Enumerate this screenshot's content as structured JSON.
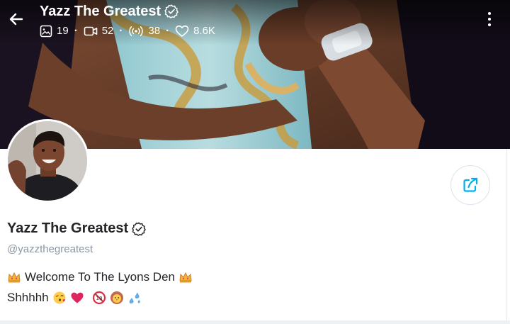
{
  "header": {
    "title": "Yazz The Greatest",
    "stats": {
      "photos": "19",
      "videos": "52",
      "streams": "38",
      "likes": "8.6K"
    }
  },
  "profile": {
    "display_name": "Yazz The Greatest",
    "username": "@yazzthegreatest",
    "bio_line1": "Welcome To The Lyons Den",
    "bio_line2": "Shhhhh"
  },
  "colors": {
    "accent": "#00aff0",
    "muted_text": "#8a96a3",
    "text": "#242529"
  },
  "icons": {
    "back": "arrow-left-icon",
    "verified": "verified-badge-icon",
    "photos": "image-icon",
    "videos": "video-icon",
    "streams": "broadcast-icon",
    "likes": "heart-icon",
    "more": "more-vertical-icon",
    "share": "share-icon",
    "bio_emojis": [
      "crown-emoji",
      "crown-emoji",
      "kiss-emoji",
      "heart-emoji",
      "no-entry-emoji",
      "lion-emoji",
      "sweat-droplets-emoji"
    ]
  }
}
